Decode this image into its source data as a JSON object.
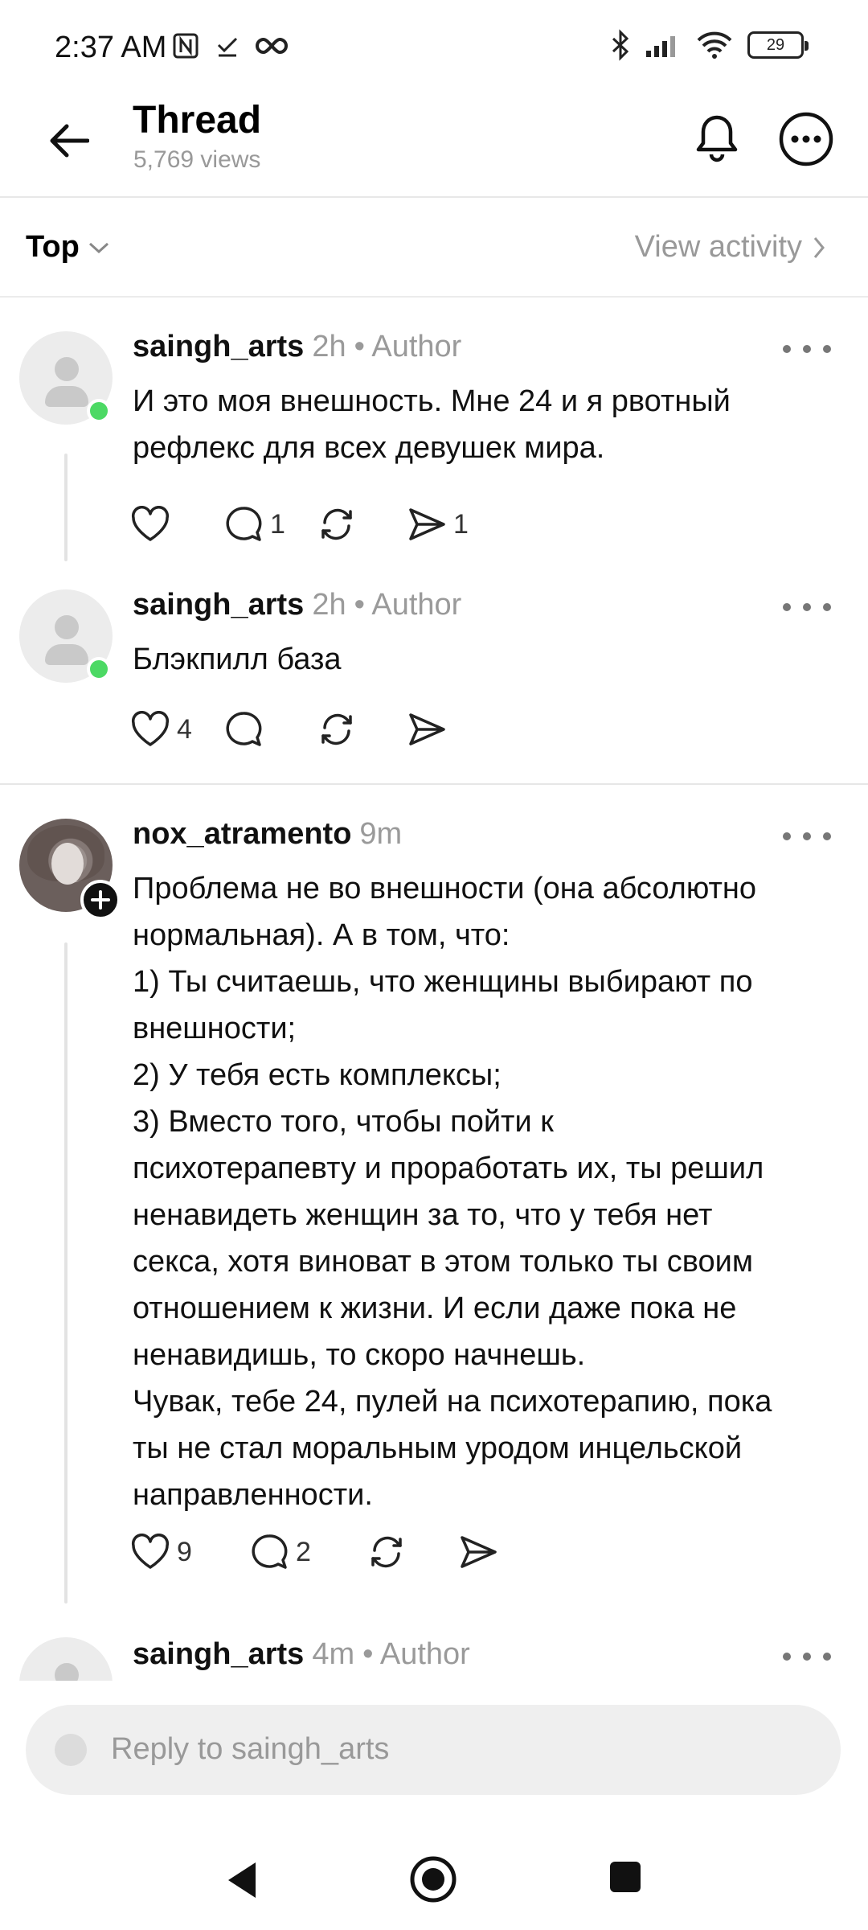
{
  "status_bar": {
    "time": "2:37 AM",
    "battery": "29",
    "icons": [
      "nfc-icon",
      "check-icon",
      "infinity-icon",
      "bluetooth-icon",
      "signal-icon",
      "wifi-icon",
      "battery-icon"
    ]
  },
  "header": {
    "title": "Thread",
    "views": "5,769 views"
  },
  "sortbar": {
    "sort_label": "Top",
    "activity_label": "View activity"
  },
  "posts": [
    {
      "username": "saingh_arts",
      "time": "2h",
      "author_badge": "• Author",
      "text": "И это моя внешность. Мне 24 и я рвотный\nрефлекс для всех девушек мира.",
      "likes": "",
      "replies": "1",
      "reposts": "",
      "shares": "1"
    },
    {
      "username": "saingh_arts",
      "time": "2h",
      "author_badge": "• Author",
      "text": "Блэкпилл база",
      "likes": "4",
      "replies": "",
      "reposts": "",
      "shares": ""
    },
    {
      "username": "nox_atramento",
      "time": "9m",
      "author_badge": "",
      "text": "Проблема не во внешности (она абсолютно\nнормальная). А в том, что:\n1) Ты считаешь, что женщины выбирают по\nвнешности;\n2) У тебя есть комплексы;\n3) Вместо того, чтобы пойти к\nпсихотерапевту и проработать их, ты решил\nненавидеть женщин за то, что у тебя нет\nсекса, хотя виноват в этом только ты своим\nотношением к жизни. И если даже пока не\nненавидишь, то скоро начнешь.\nЧувак, тебе 24, пулей на психотерапию, пока\nты не стал моральным уродом инцельской\nнаправленности.",
      "likes": "9",
      "replies": "2",
      "reposts": "",
      "shares": ""
    },
    {
      "username": "saingh_arts",
      "time": "4m",
      "author_badge": "• Author"
    }
  ],
  "reply_bar": {
    "placeholder": "Reply to saingh_arts"
  },
  "colors": {
    "online": "#4cd964",
    "muted": "#999999",
    "reply_bg": "#efefef"
  }
}
